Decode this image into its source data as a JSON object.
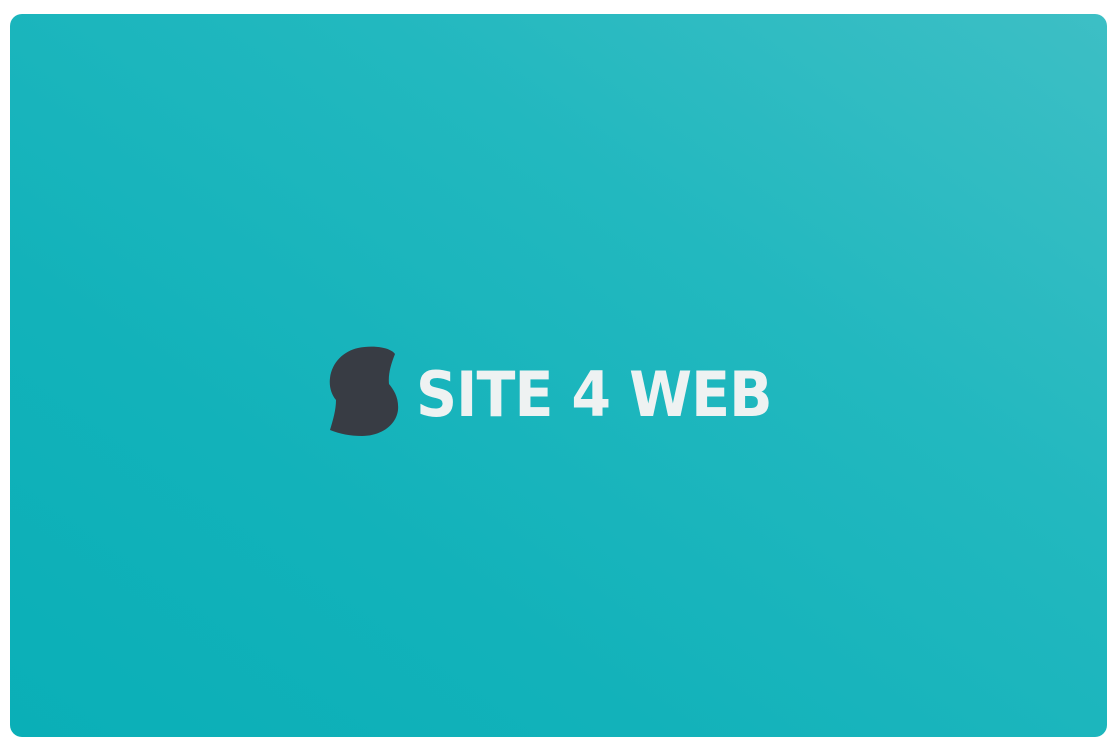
{
  "brand": {
    "name": "SITE 4 WEB",
    "mark_icon": "s-blob-logo-icon",
    "text_color": "#eef2f2",
    "mark_color": "#383c44"
  },
  "colors": {
    "background_start": "#3dbfc5",
    "background_end": "#0aafb7",
    "page": "#ffffff"
  }
}
